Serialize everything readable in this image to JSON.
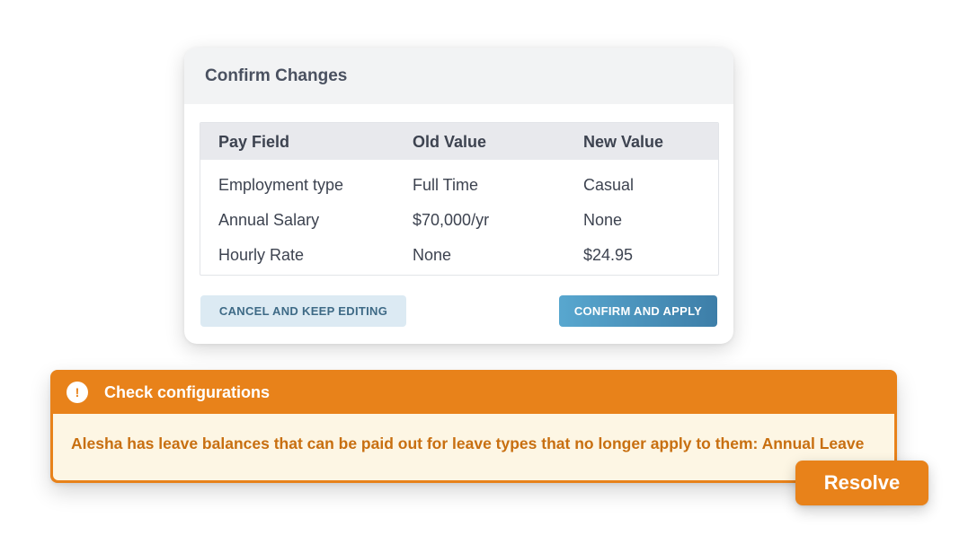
{
  "dialog": {
    "title": "Confirm Changes",
    "columns": [
      "Pay Field",
      "Old Value",
      "New Value"
    ],
    "rows": [
      {
        "field": "Employment type",
        "old": "Full Time",
        "new": "Casual"
      },
      {
        "field": "Annual Salary",
        "old": "$70,000/yr",
        "new": "None"
      },
      {
        "field": "Hourly Rate",
        "old": "None",
        "new": "$24.95"
      }
    ],
    "cancel_label": "CANCEL AND KEEP EDITING",
    "confirm_label": "CONFIRM AND APPLY"
  },
  "alert": {
    "icon": "exclamation-icon",
    "title": "Check configurations",
    "message": "Alesha has leave balances that can be paid out for leave types that no longer apply to them: Annual Leave",
    "resolve_label": "Resolve",
    "color": "#e8821a"
  },
  "colors": {
    "confirm_button": "#3d7ea8",
    "cancel_button_bg": "#dceaf3",
    "alert_body_bg": "#fdf6e4",
    "alert_text": "#c86f10"
  }
}
